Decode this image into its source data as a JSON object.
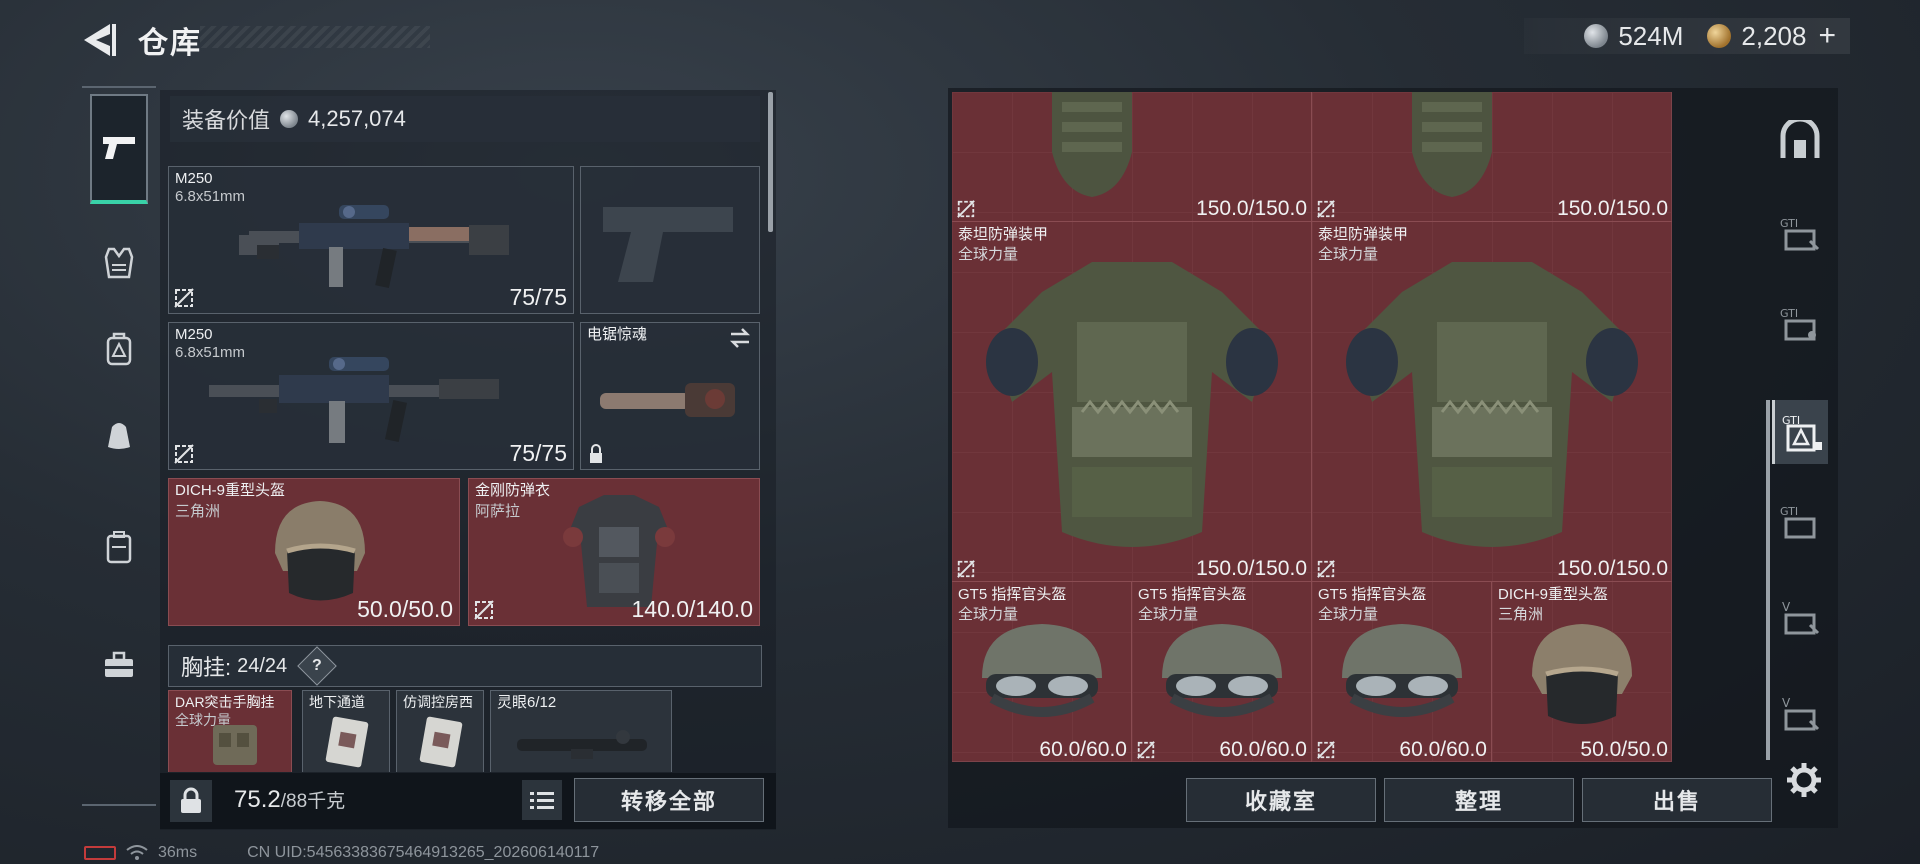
{
  "header": {
    "title": "仓库",
    "currency": [
      {
        "icon": "silver-coin-icon",
        "value": "524M"
      },
      {
        "icon": "gold-coin-icon",
        "value": "2,208"
      }
    ],
    "plus": "+"
  },
  "left_categories": [
    {
      "icon": "pistol-icon",
      "active": true
    },
    {
      "icon": "armor-vest-icon",
      "active": false
    },
    {
      "icon": "backpack-icon",
      "active": false
    },
    {
      "icon": "pouch-icon",
      "active": false
    },
    {
      "icon": "case-icon",
      "active": false
    },
    {
      "icon": "toolbox-icon",
      "active": false
    }
  ],
  "equipment": {
    "value_label": "装备价值",
    "value": "4,257,074",
    "primary_1": {
      "name": "M250",
      "caliber": "6.8x51mm",
      "durability": "75/75"
    },
    "primary_2": {
      "name": "M250",
      "caliber": "6.8x51mm",
      "durability": "75/75"
    },
    "melee": {
      "name": "电锯惊魂"
    },
    "helmet": {
      "name": "DICH-9重型头盔",
      "source": "三角洲",
      "durability": "50.0/50.0"
    },
    "armor": {
      "name": "金刚防弹衣",
      "source": "阿萨拉",
      "durability": "140.0/140.0"
    },
    "chest_rig": {
      "label": "胸挂:",
      "capacity": "24/24",
      "help": "?"
    },
    "rig_items": [
      {
        "name": "DAR突击手胸挂",
        "source": "全球力量"
      },
      {
        "name": "地下通道"
      },
      {
        "name": "仿调控房西"
      },
      {
        "name": "灵眼6/12"
      }
    ]
  },
  "footer": {
    "weight": "75.2",
    "weight_max": "/88千克",
    "transfer_all": "转移全部"
  },
  "status": {
    "ping": "36ms",
    "uid": "CN UID:54563383675464913265_202606140117"
  },
  "stash": {
    "items": [
      {
        "name": "",
        "source": "",
        "durability": "150.0/150.0"
      },
      {
        "name": "",
        "source": "",
        "durability": "150.0/150.0"
      },
      {
        "name": "泰坦防弹装甲",
        "source": "全球力量",
        "durability": "150.0/150.0"
      },
      {
        "name": "泰坦防弹装甲",
        "source": "全球力量",
        "durability": "150.0/150.0"
      },
      {
        "name": "GT5 指挥官头盔",
        "source": "全球力量",
        "durability": "60.0/60.0"
      },
      {
        "name": "GT5 指挥官头盔",
        "source": "全球力量",
        "durability": "60.0/60.0"
      },
      {
        "name": "GT5 指挥官头盔",
        "source": "全球力量",
        "durability": "60.0/60.0"
      },
      {
        "name": "DICH-9重型头盔",
        "source": "三角洲",
        "durability": "50.0/50.0"
      }
    ],
    "buttons": {
      "collection": "收藏室",
      "organize": "整理",
      "sell": "出售"
    }
  },
  "right_tabs": [
    {
      "icon": "gate-icon",
      "label": ""
    },
    {
      "icon": "gti-case-icon",
      "label": "GTI"
    },
    {
      "icon": "gti-case-icon",
      "label": "GTI"
    },
    {
      "icon": "gti-tech-icon",
      "label": "GTI",
      "active": true
    },
    {
      "icon": "gti-case-icon",
      "label": "GTI"
    },
    {
      "icon": "v-case-icon",
      "label": "V"
    },
    {
      "icon": "v-case-icon",
      "label": "V"
    }
  ]
}
